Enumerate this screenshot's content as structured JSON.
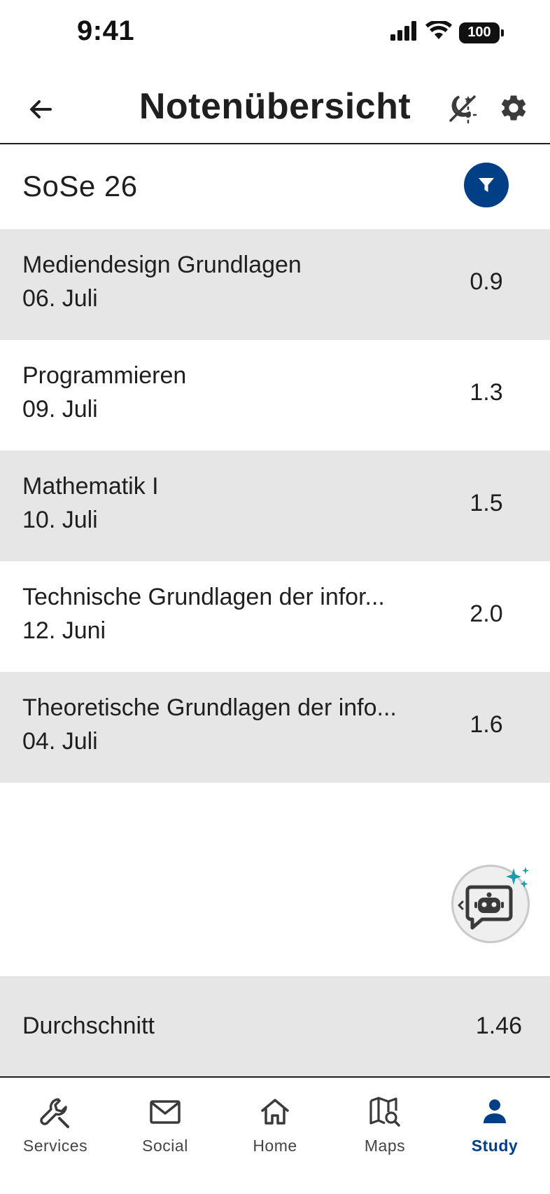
{
  "status_bar": {
    "time": "9:41",
    "battery": "100"
  },
  "header": {
    "title": "Notenübersicht"
  },
  "semester": {
    "label": "SoSe 26"
  },
  "grades": [
    {
      "course": "Mediendesign Grundlagen",
      "date": "06. Juli",
      "grade": "0.9"
    },
    {
      "course": "Programmieren",
      "date": "09. Juli",
      "grade": "1.3"
    },
    {
      "course": "Mathematik I",
      "date": "10. Juli",
      "grade": "1.5"
    },
    {
      "course": "Technische Grundlagen der infor...",
      "date": "12. Juni",
      "grade": "2.0"
    },
    {
      "course": "Theoretische Grundlagen der info...",
      "date": "04. Juli",
      "grade": "1.6"
    }
  ],
  "average": {
    "label": "Durchschnitt",
    "value": "1.46"
  },
  "bottom_nav": [
    {
      "label": "Services",
      "icon": "wrench-icon"
    },
    {
      "label": "Social",
      "icon": "mail-icon"
    },
    {
      "label": "Home",
      "icon": "home-icon"
    },
    {
      "label": "Maps",
      "icon": "map-search-icon"
    },
    {
      "label": "Study",
      "icon": "person-icon",
      "active": true
    }
  ],
  "colors": {
    "accent": "#003f86",
    "row_shade": "#e6e6e6",
    "sparkle": "#1a9bb0"
  }
}
